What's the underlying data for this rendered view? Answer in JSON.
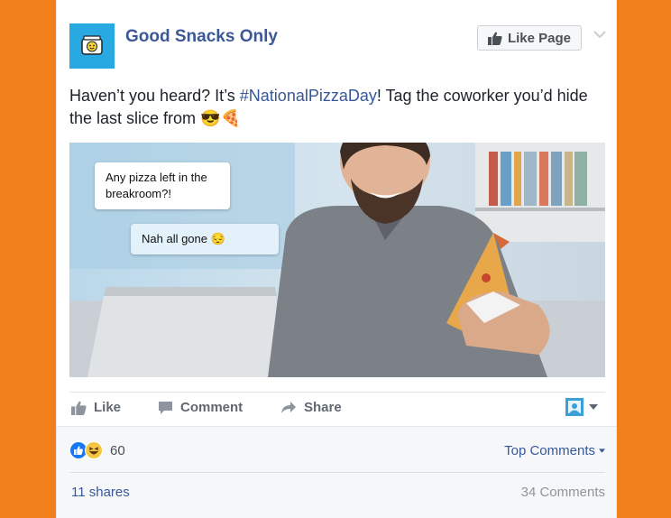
{
  "post": {
    "page_name": "Good Snacks Only",
    "like_page_label": "Like Page",
    "text_before": "Haven’t you heard? It’s ",
    "hashtag": "#NationalPizzaDay",
    "text_after": "! Tag the coworker you’d hide the last slice from ",
    "text_emojis": "😎🍕",
    "image": {
      "bubble_1": "Any pizza left in the breakroom?!",
      "bubble_2": "Nah all gone 😔"
    }
  },
  "actions": {
    "like": "Like",
    "comment": "Comment",
    "share": "Share"
  },
  "stats": {
    "reaction_count": "60",
    "top_comments": "Top Comments",
    "shares": "11 shares",
    "comments": "34 Comments"
  },
  "colors": {
    "background": "#f07f1c",
    "link_blue": "#365899",
    "brand_blue": "#3b5998",
    "avatar_bg": "#29a9e1"
  },
  "icons": [
    "snack-bag-icon",
    "thumbs-up-icon",
    "chevron-down-icon",
    "comment-icon",
    "share-arrow-icon",
    "like-reaction-icon",
    "haha-reaction-icon",
    "caret-down-icon"
  ]
}
